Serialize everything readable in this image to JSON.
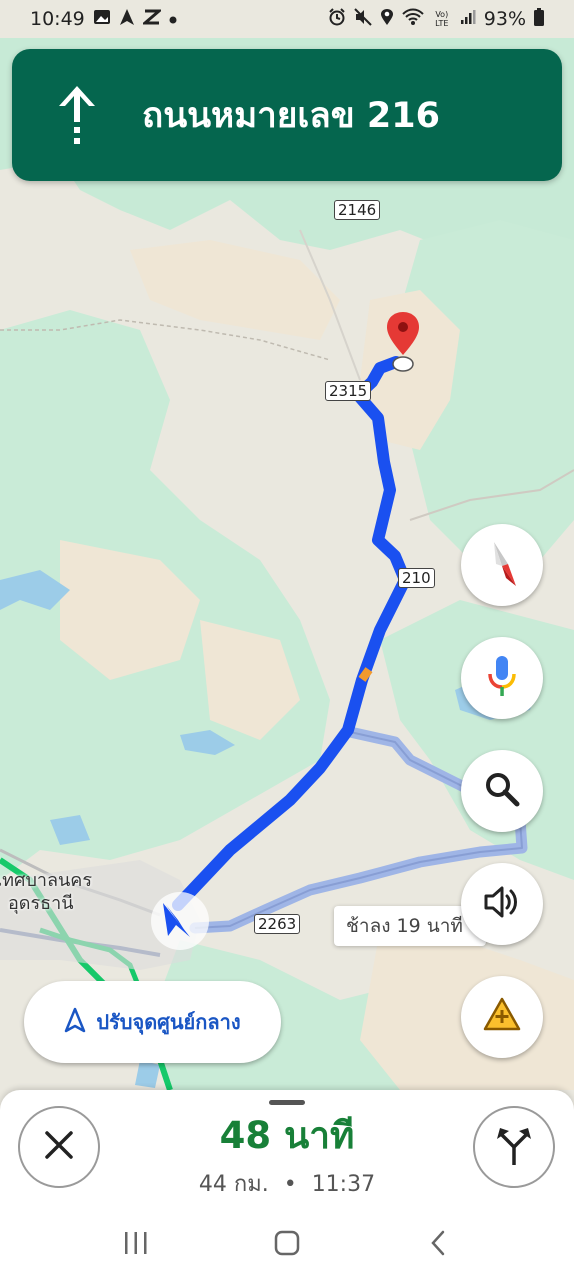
{
  "status_bar": {
    "time": "10:49",
    "battery": "93%",
    "left_icons": [
      "gallery-icon",
      "navigation-icon",
      "link-icon",
      "dot-icon"
    ],
    "right_icons": [
      "alarm-icon",
      "mute-icon",
      "location-icon",
      "wifi-icon",
      "volte-icon",
      "signal-icon",
      "battery-icon"
    ],
    "volte_label": "Vo) LTE"
  },
  "navigation": {
    "street": "ถนนหมายเลข 216",
    "direction": "straight",
    "banner_color": "#05664e"
  },
  "map": {
    "road_shields": [
      "2146",
      "2315",
      "210",
      "2263"
    ],
    "place_label_line1": "เทศบาลนคร",
    "place_label_line2": "อุดรธานี",
    "alt_route_label": "ช้าลง 19 นาที",
    "route_color": "#1a50f0",
    "alt_route_color": "#9fb5e6"
  },
  "buttons": {
    "recenter": "ปรับจุดศูนย์กลาง"
  },
  "bottom": {
    "eta_minutes": "48 นาที",
    "distance": "44 กม.",
    "separator": "•",
    "arrival_time": "11:37"
  }
}
